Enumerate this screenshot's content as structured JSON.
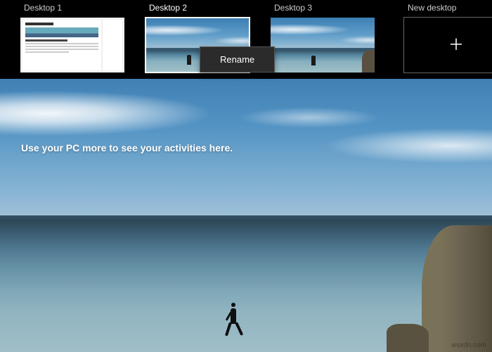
{
  "desktops": [
    {
      "label": "Desktop 1"
    },
    {
      "label": "Desktop 2"
    },
    {
      "label": "Desktop 3"
    }
  ],
  "new_desktop_label": "New desktop",
  "context_menu": {
    "rename": "Rename"
  },
  "activity_message": "Use your PC more to see your activities here.",
  "watermark": "wsxdn.com"
}
